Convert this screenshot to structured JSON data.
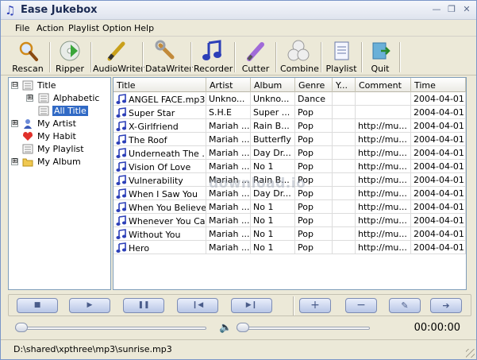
{
  "window": {
    "title": "Ease Jukebox",
    "controls": {
      "minimize": "—",
      "restore": "❐",
      "close": "✕"
    }
  },
  "menu": [
    "File",
    "Action",
    "Playlist",
    "Option",
    "Help"
  ],
  "toolbar": [
    {
      "label": "Rescan",
      "icon": "magnifier-icon"
    },
    {
      "label": "Ripper",
      "icon": "cd-ripper-icon"
    },
    {
      "label": "AudioWriter",
      "icon": "pen-icon"
    },
    {
      "label": "DataWriter",
      "icon": "wrench-icon"
    },
    {
      "label": "Recorder",
      "icon": "music-note-icon"
    },
    {
      "label": "Cutter",
      "icon": "knife-icon"
    },
    {
      "label": "Combine",
      "icon": "discs-icon"
    },
    {
      "label": "Playlist",
      "icon": "playlist-icon"
    },
    {
      "label": "Quit",
      "icon": "quit-icon"
    }
  ],
  "tree": [
    {
      "label": "Title",
      "expander": "⊟",
      "level": 0
    },
    {
      "label": "Alphabetic",
      "expander": "⊞",
      "level": 1
    },
    {
      "label": "All Title",
      "expander": "",
      "level": 1,
      "selected": true
    },
    {
      "label": "My Artist",
      "expander": "⊞",
      "level": 0
    },
    {
      "label": "My Habit",
      "expander": "",
      "level": 0
    },
    {
      "label": "My Playlist",
      "expander": "",
      "level": 0
    },
    {
      "label": "My Album",
      "expander": "⊞",
      "level": 0
    }
  ],
  "columns": [
    "Title",
    "Artist",
    "Album",
    "Genre",
    "Y...",
    "Comment",
    "Time"
  ],
  "rows": [
    [
      "ANGEL FACE.mp3",
      "Unkno...",
      "Unkno...",
      "Dance",
      "",
      "",
      "2004-04-01..."
    ],
    [
      "Super Star",
      "S.H.E",
      "Super ...",
      "Pop",
      "",
      "",
      "2004-04-01..."
    ],
    [
      "X-Girlfriend",
      "Mariah ...",
      "Rain B...",
      "Pop",
      "",
      "http://mu...",
      "2004-04-01..."
    ],
    [
      "The Roof",
      "Mariah ...",
      "Butterfly",
      "Pop",
      "",
      "http://mu...",
      "2004-04-01..."
    ],
    [
      "Underneath The ...",
      "Mariah ...",
      "Day Dr...",
      "Pop",
      "",
      "http://mu...",
      "2004-04-01..."
    ],
    [
      "Vision Of Love",
      "Mariah ...",
      "No 1",
      "Pop",
      "",
      "http://mu...",
      "2004-04-01..."
    ],
    [
      "Vulnerability",
      "Mariah ...",
      "Rain B...",
      "Pop",
      "",
      "http://mu...",
      "2004-04-01..."
    ],
    [
      "When I Saw You",
      "Mariah ...",
      "Day Dr...",
      "Pop",
      "",
      "http://mu...",
      "2004-04-01..."
    ],
    [
      "When You Believe",
      "Mariah ...",
      "No 1",
      "Pop",
      "",
      "http://mu...",
      "2004-04-01..."
    ],
    [
      "Whenever You Can",
      "Mariah ...",
      "No 1",
      "Pop",
      "",
      "http://mu...",
      "2004-04-01..."
    ],
    [
      "Without You",
      "Mariah ...",
      "No 1",
      "Pop",
      "",
      "http://mu...",
      "2004-04-01..."
    ],
    [
      "Hero",
      "Mariah ...",
      "No 1",
      "Pop",
      "",
      "http://mu...",
      "2004-04-01..."
    ]
  ],
  "controls": [
    {
      "name": "stop-button",
      "glyph": "■"
    },
    {
      "name": "play-button",
      "glyph": "▶"
    },
    {
      "name": "pause-button",
      "glyph": "❚❚"
    },
    {
      "name": "previous-button",
      "glyph": "❙◀"
    },
    {
      "name": "next-button",
      "glyph": "▶❙"
    },
    {
      "name": "add-button",
      "glyph": "+"
    },
    {
      "name": "remove-button",
      "glyph": "−"
    },
    {
      "name": "edit-button",
      "glyph": "✎"
    },
    {
      "name": "forward-button",
      "glyph": "➔"
    }
  ],
  "playback": {
    "time": "00:00:00",
    "position": 0.0,
    "volume": 0.0
  },
  "status": {
    "path": "D:\\shared\\xpthree\\mp3\\sunrise.mp3"
  },
  "watermark": "download.io",
  "colors": {
    "accent": "#316ac5",
    "note": "#2c3fb8",
    "window_bg": "#ece9d8"
  }
}
